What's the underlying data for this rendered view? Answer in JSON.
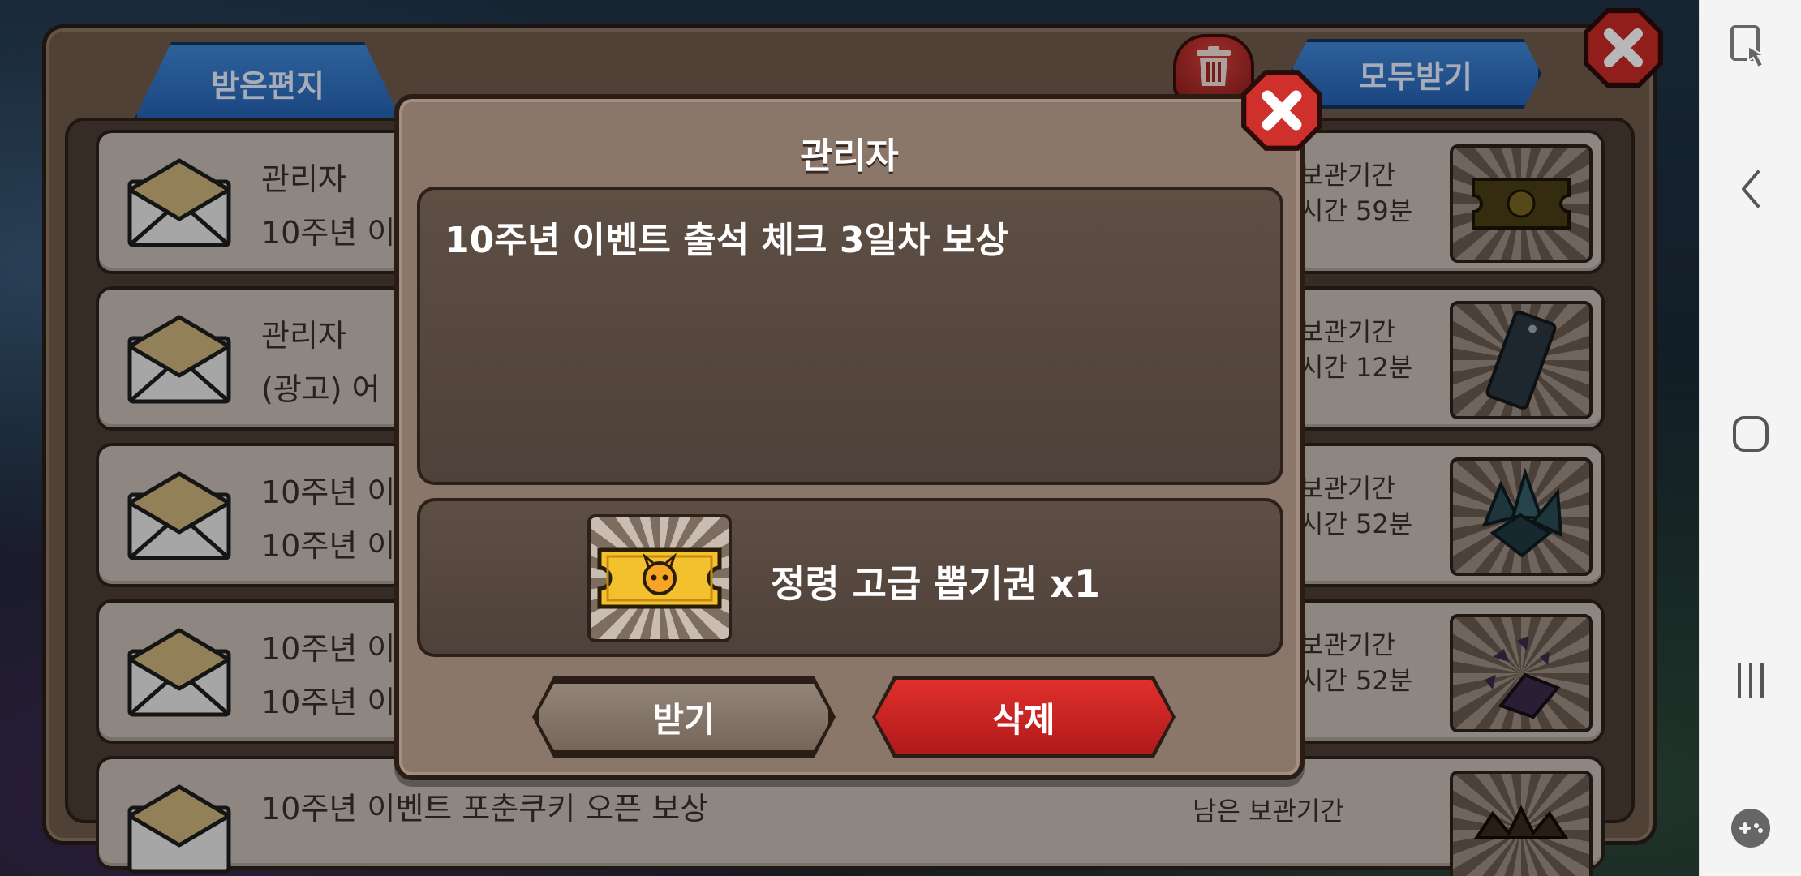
{
  "mailbox": {
    "tab_received": "받은편지",
    "claim_all": "모두받기",
    "rows": [
      {
        "sender": "관리자",
        "subject": "10주년 이",
        "remain_label": "보관기간",
        "remain_time": "시간 59분",
        "item_icon": "event-ticket-icon"
      },
      {
        "sender": "관리자",
        "subject": "(광고) 어",
        "remain_label": "보관기간",
        "remain_time": "시간 12분",
        "item_icon": "ticket-icon"
      },
      {
        "sender": "10주년 이",
        "subject": "10주년 이",
        "remain_label": "보관기간",
        "remain_time": "시간 52분",
        "item_icon": "crystal-icon"
      },
      {
        "sender": "10주년 이",
        "subject": "10주년 이",
        "remain_label": "보관기간",
        "remain_time": "시간 52분",
        "item_icon": "shard-icon"
      },
      {
        "sender": "",
        "subject": "10주년 이벤트 포춘쿠키 오픈 보상",
        "remain_label": "남은 보관기간",
        "remain_time": "",
        "item_icon": "reward-icon"
      }
    ]
  },
  "dialog": {
    "title": "관리자",
    "message": "10주년 이벤트 출석 체크 3일차 보상",
    "reward_label": "정령 고급 뽑기권 x1",
    "reward_icon": "spirit-ticket-icon",
    "receive_button": "받기",
    "delete_button": "삭제"
  },
  "colors": {
    "accent_blue": "#2f72c6",
    "delete_red": "#c8201f",
    "dialog_bg": "#8b766a"
  }
}
